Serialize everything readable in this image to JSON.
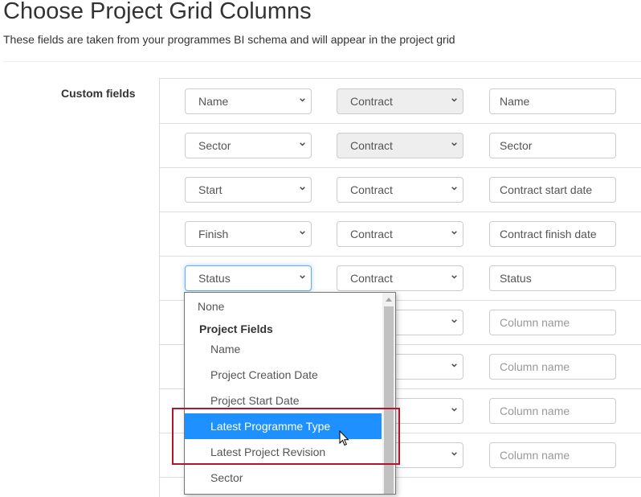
{
  "page": {
    "title": "Choose Project Grid Columns",
    "subtitle": "These fields are taken from your programmes BI schema and will appear in the project grid"
  },
  "section": {
    "label": "Custom fields"
  },
  "rows": [
    {
      "field": "Name",
      "source": "Contract",
      "source_disabled": true,
      "column_name": "Name",
      "placeholder": "Column name"
    },
    {
      "field": "Sector",
      "source": "Contract",
      "source_disabled": true,
      "column_name": "Sector",
      "placeholder": "Column name"
    },
    {
      "field": "Start",
      "source": "Contract",
      "source_disabled": false,
      "column_name": "Contract start date",
      "placeholder": "Column name"
    },
    {
      "field": "Finish",
      "source": "Contract",
      "source_disabled": false,
      "column_name": "Contract finish date",
      "placeholder": "Column name"
    },
    {
      "field": "Status",
      "source": "Contract",
      "source_disabled": false,
      "column_name": "Status",
      "placeholder": "Column name"
    },
    {
      "field": "",
      "source": "",
      "source_disabled": false,
      "column_name": "",
      "placeholder": "Column name"
    },
    {
      "field": "",
      "source": "",
      "source_disabled": false,
      "column_name": "",
      "placeholder": "Column name"
    },
    {
      "field": "",
      "source": "",
      "source_disabled": false,
      "column_name": "",
      "placeholder": "Column name"
    },
    {
      "field": "",
      "source": "",
      "source_disabled": false,
      "column_name": "",
      "placeholder": "Column name"
    }
  ],
  "dropdown": {
    "open_for_row": 4,
    "options": [
      {
        "label": "None",
        "type": "option",
        "indent": false
      },
      {
        "label": "Project Fields",
        "type": "group"
      },
      {
        "label": "Name",
        "type": "option",
        "indent": true
      },
      {
        "label": "Project Creation Date",
        "type": "option",
        "indent": true
      },
      {
        "label": "Project Start Date",
        "type": "option",
        "indent": true
      },
      {
        "label": "Latest Programme Type",
        "type": "option",
        "indent": true,
        "highlighted": true
      },
      {
        "label": "Latest Project Revision",
        "type": "option",
        "indent": true
      },
      {
        "label": "Sector",
        "type": "option",
        "indent": true
      }
    ]
  },
  "colors": {
    "highlight": "#1e90ff",
    "annotation_box": "#b0172b",
    "focus_border": "#66afe9"
  }
}
